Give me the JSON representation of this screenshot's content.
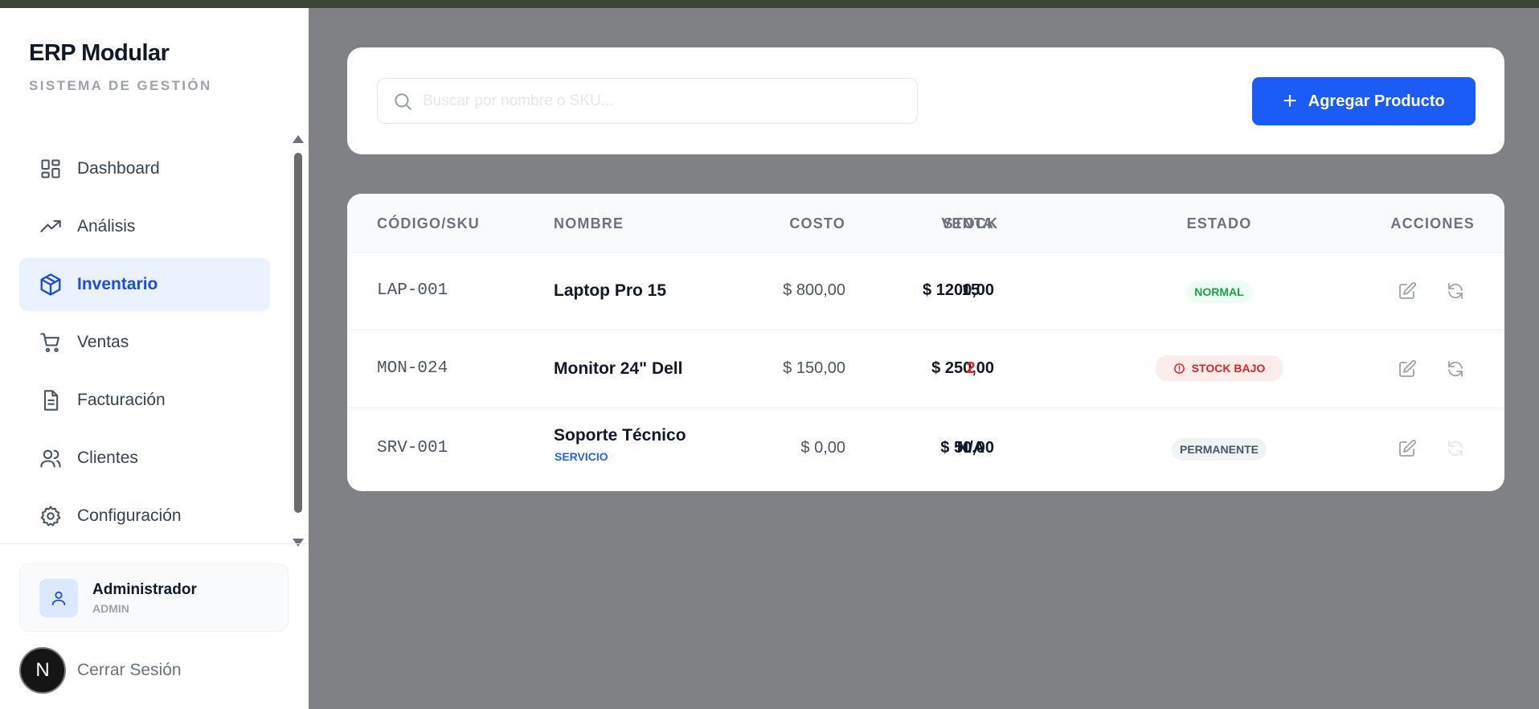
{
  "sidebar": {
    "brand_title": "ERP Modular",
    "brand_subtitle": "SISTEMA DE GESTIÓN",
    "items": [
      {
        "label": "Dashboard",
        "icon": "dashboard-grid-icon"
      },
      {
        "label": "Análisis",
        "icon": "trending-up-icon"
      },
      {
        "label": "Inventario",
        "icon": "package-icon",
        "active": true
      },
      {
        "label": "Ventas",
        "icon": "shopping-cart-icon"
      },
      {
        "label": "Facturación",
        "icon": "document-icon"
      },
      {
        "label": "Clientes",
        "icon": "users-icon"
      },
      {
        "label": "Configuración",
        "icon": "gear-icon"
      }
    ],
    "user": {
      "name": "Administrador",
      "role": "ADMIN"
    },
    "logout_label": "Cerrar Sesión",
    "badge_letter": "N"
  },
  "toolbar": {
    "search_placeholder": "Buscar por nombre o SKU...",
    "add_button_label": "Agregar Producto"
  },
  "table": {
    "headers": {
      "sku": "CÓDIGO/SKU",
      "name": "NOMBRE",
      "cost": "COSTO",
      "sale": "VENTA",
      "stock": "STOCK",
      "status": "ESTADO",
      "actions": "ACCIONES"
    },
    "rows": [
      {
        "sku": "LAP-001",
        "name": "Laptop Pro 15",
        "type": "",
        "cost": "$ 800,00",
        "sale": "$ 1200,00",
        "stock": "15",
        "status": "NORMAL"
      },
      {
        "sku": "MON-024",
        "name": "Monitor 24\" Dell",
        "type": "",
        "cost": "$ 150,00",
        "sale": "$ 250,00",
        "stock": "2",
        "status": "STOCK BAJO"
      },
      {
        "sku": "SRV-001",
        "name": "Soporte Técnico",
        "type": "SERVICIO",
        "cost": "$ 0,00",
        "sale": "$ 50,00",
        "stock": "N/A",
        "status": "PERMANENTE"
      }
    ]
  },
  "colors": {
    "accent": "#1a5cf5",
    "active_bg": "#eaf2ff",
    "danger": "#dc2626",
    "success": "#16a34a",
    "backdrop": "#808184"
  }
}
